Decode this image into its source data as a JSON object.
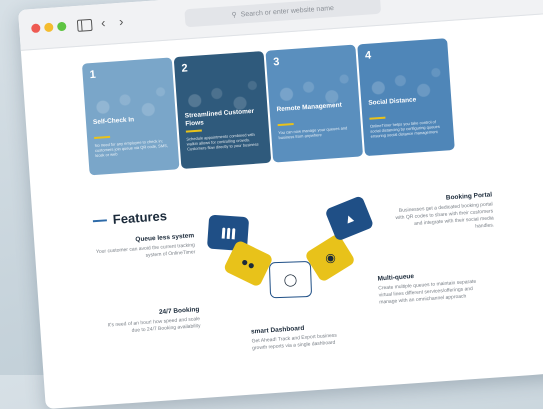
{
  "browser": {
    "url_placeholder": "Search or enter website name",
    "icons": [
      "close-dot",
      "minimize-dot",
      "zoom-dot",
      "sidebar-icon",
      "back-icon",
      "forward-icon",
      "search-icon",
      "plus-icon",
      "tabs-icon"
    ]
  },
  "cards": [
    {
      "num": "1",
      "title": "Self-Check In",
      "text": "No need for any employee to check in; customers join queue via QR code, SMS, kiosk or web",
      "color": "#7aa6c9"
    },
    {
      "num": "2",
      "title": "Streamlined Customer Flows",
      "text": "Schedule appointments combined with walkin allows for controlling crowds. Customers flow directly to your business",
      "color": "#2f5a7c"
    },
    {
      "num": "3",
      "title": "Remote Management",
      "text": "You can now manage your queues and business from anywhere",
      "color": "#5a8fbe"
    },
    {
      "num": "4",
      "title": "Social Distance",
      "text": "OnlineTimer helps you take control of social distancing by configuring queues ensuring social distance management",
      "color": "#4f86b8"
    }
  ],
  "features": {
    "title": "Features",
    "items": {
      "queue": {
        "title": "Queue less system",
        "text": "Your customer can avoid the current tracking system of OnlineTimer"
      },
      "booking": {
        "title": "24/7 Booking",
        "text": "It's need of an hour! how speed and scale due to 24/7 Booking availability"
      },
      "portal": {
        "title": "Booking Portal",
        "text": "Businesses get a dedicated booking portal with QR codes to share with their customers and integrate with their social media handles."
      },
      "multi": {
        "title": "Multi-queue",
        "text": "Create multiple queues to maintain separate virtual lines different services/offerings and manage with an omnichannel approach"
      },
      "smart": {
        "title": "smart Dashboard",
        "text": "Get Ahead! Track and Export business growth reports via a single dashboard"
      }
    },
    "segment_icons": [
      "people-icon",
      "team-icon",
      "support-icon",
      "eye-icon",
      "thumbs-up-icon"
    ],
    "colors": {
      "blue": "#1f4f86",
      "yellow": "#e8c21a",
      "accent": "#2d6aa8"
    }
  }
}
